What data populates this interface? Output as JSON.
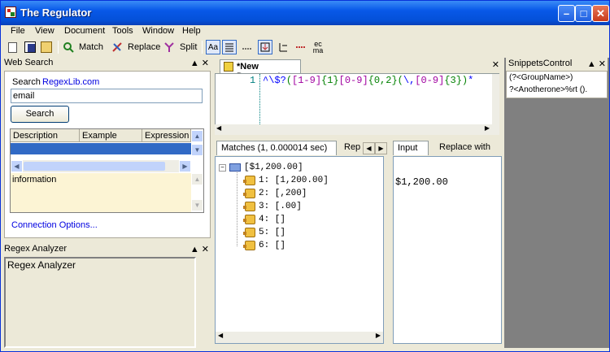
{
  "window": {
    "title": "The Regulator"
  },
  "menu": [
    "File",
    "View",
    "Document",
    "Tools",
    "Window",
    "Help"
  ],
  "toolbar": {
    "match": "Match",
    "replace": "Replace",
    "split": "Split",
    "ignore_case": "Aa",
    "ecma_top": "ec",
    "ecma_bottom": "ma"
  },
  "web_search": {
    "title": "Web Search",
    "search_label": "Search",
    "site_link": "RegexLib.com",
    "query": "email",
    "search_button": "Search",
    "columns": [
      "Description",
      "Example",
      "Expression"
    ],
    "info_text": "information",
    "connection_link": "Connection Options..."
  },
  "regex_analyzer": {
    "title": "Regex Analyzer",
    "content": "Regex Analyzer"
  },
  "editor": {
    "tab_title": "*New Document",
    "line_number": "1",
    "segments": [
      {
        "t": "^\\$?",
        "c": "#0000ff"
      },
      {
        "t": "(",
        "c": "#008000"
      },
      {
        "t": "[1-9]",
        "c": "#a000a0"
      },
      {
        "t": "{1}",
        "c": "#008000"
      },
      {
        "t": "[0-9]",
        "c": "#a000a0"
      },
      {
        "t": "{0,2}",
        "c": "#008000"
      },
      {
        "t": "(",
        "c": "#008000"
      },
      {
        "t": "\\,",
        "c": "#0000ff"
      },
      {
        "t": "[0-9]",
        "c": "#a000a0"
      },
      {
        "t": "{3}",
        "c": "#008000"
      },
      {
        "t": ")",
        "c": "#008000"
      },
      {
        "t": "*",
        "c": "#0000ff"
      }
    ]
  },
  "matches": {
    "tab_label": "Matches (1, 0.000014 sec)",
    "rep_tab": "Rep",
    "root": "[$1,200.00]",
    "groups": [
      "1: [1,200.00]",
      "2: [,200]",
      "3: [.00]",
      "4: []",
      "5: []",
      "6: []"
    ]
  },
  "input": {
    "tab": "Input",
    "replace_tab": "Replace with",
    "value": "$1,200.00"
  },
  "snippets": {
    "title": "SnippetsControl",
    "items": [
      "(?<GroupName>)",
      "?<Anotherone>%rt ()."
    ]
  }
}
